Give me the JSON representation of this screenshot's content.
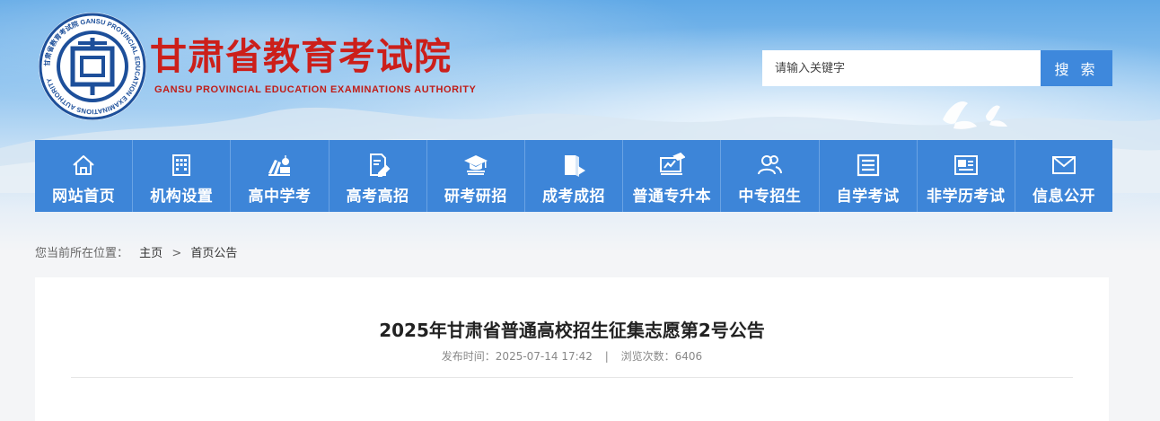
{
  "header": {
    "emblem_char": "国",
    "site_name_cn": "甘肃省教育考试院",
    "site_name_en": "GANSU PROVINCIAL EDUCATION EXAMINATIONS AUTHORITY",
    "emblem_ring_text": "甘肃省教育考试院 GANSU PROVINCIAL EDUCATION EXAMINATIONS AUTHORITY"
  },
  "search": {
    "placeholder": "请输入关键字",
    "button_label": "搜 索"
  },
  "nav": {
    "items": [
      {
        "label": "网站首页",
        "icon": "home-icon"
      },
      {
        "label": "机构设置",
        "icon": "building-icon"
      },
      {
        "label": "高中学考",
        "icon": "books-icon"
      },
      {
        "label": "高考高招",
        "icon": "exam-paper-icon"
      },
      {
        "label": "研考研招",
        "icon": "graduation-cap-icon"
      },
      {
        "label": "成考成招",
        "icon": "book-icon"
      },
      {
        "label": "普通专升本",
        "icon": "presentation-icon"
      },
      {
        "label": "中专招生",
        "icon": "users-icon"
      },
      {
        "label": "自学考试",
        "icon": "document-icon"
      },
      {
        "label": "非学历考试",
        "icon": "id-card-icon"
      },
      {
        "label": "信息公开",
        "icon": "mail-icon"
      }
    ]
  },
  "breadcrumb": {
    "prefix": "您当前所在位置：",
    "home": "主页",
    "separator": ">",
    "current": "首页公告"
  },
  "article": {
    "title": "2025年甘肃省普通高校招生征集志愿第2号公告",
    "publish_label": "发布时间：",
    "publish_time": "2025-07-14 17:42",
    "separator": "|",
    "views_label": "浏览次数：",
    "views": "6406"
  },
  "colors": {
    "brand_red": "#cc1f1a",
    "nav_blue": "#3d85d8",
    "search_blue": "#3e88dc",
    "emblem_blue": "#1d4f9a"
  }
}
